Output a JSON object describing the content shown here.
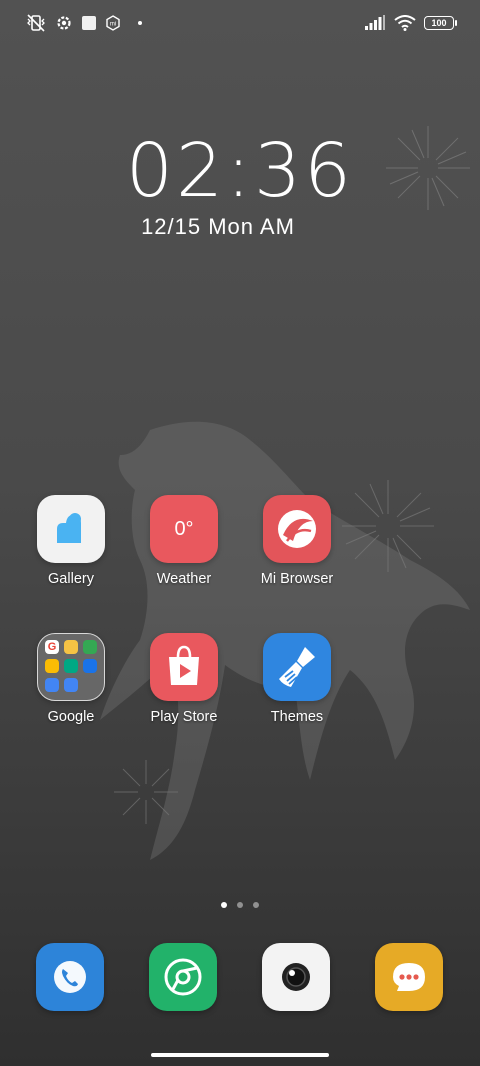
{
  "status_bar": {
    "left_icons": [
      "vibrate-off-icon",
      "settings-gear-icon",
      "square-notification-icon",
      "mi-app-icon",
      "dot-icon"
    ],
    "battery": "100",
    "right_icons": [
      "signal-icon",
      "wifi-icon",
      "battery-icon"
    ]
  },
  "lockclock": {
    "time": "02:36",
    "date": "12/15 Mon AM"
  },
  "apps": [
    {
      "label": "Gallery",
      "icon": "gallery-icon",
      "color": "#f2f2f2"
    },
    {
      "label": "Weather",
      "icon": "weather-icon",
      "color": "#e9585e",
      "icon_text": "0°"
    },
    {
      "label": "Mi Browser",
      "icon": "mi-browser-icon",
      "color": "#e3555a"
    },
    {
      "label": "Google",
      "icon": "google-folder-icon",
      "color": "#6a6a6a"
    },
    {
      "label": "Play Store",
      "icon": "play-store-icon",
      "color": "#e9585e"
    },
    {
      "label": "Themes",
      "icon": "themes-icon",
      "color": "#2f86e0"
    }
  ],
  "page_indicator": {
    "count": 3,
    "active": 1
  },
  "dock": [
    {
      "icon": "phone-icon",
      "color": "#2d84d9"
    },
    {
      "icon": "chrome-icon",
      "color": "#22b26a"
    },
    {
      "icon": "camera-icon",
      "color": "#f3f3f3"
    },
    {
      "icon": "messages-icon",
      "color": "#e6aa26"
    }
  ]
}
